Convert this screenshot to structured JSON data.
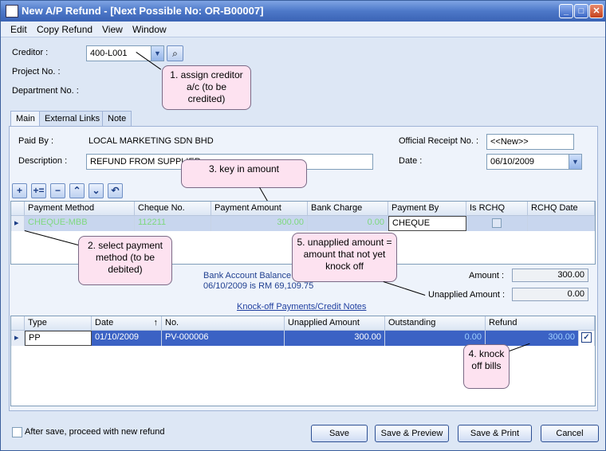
{
  "window": {
    "title": "New A/P Refund - [Next Possible No: OR-B00007]"
  },
  "menu": [
    "Edit",
    "Copy Refund",
    "View",
    "Window"
  ],
  "header": {
    "creditor_label": "Creditor :",
    "creditor_value": "400-L001",
    "project_label": "Project No. :",
    "department_label": "Department No. :"
  },
  "tabs": [
    "Main",
    "External Links",
    "Note"
  ],
  "main": {
    "paid_by_label": "Paid By :",
    "paid_by_value": "LOCAL MARKETING SDN BHD",
    "description_label": "Description :",
    "description_value": "REFUND FROM SUPPLIER",
    "receipt_label": "Official Receipt No. :",
    "receipt_value": "<<New>>",
    "date_label": "Date :",
    "date_value": "06/10/2009"
  },
  "payment_grid": {
    "columns": [
      "Payment Method",
      "Cheque No.",
      "Payment Amount",
      "Bank Charge",
      "Payment By",
      "Is RCHQ",
      "RCHQ Date"
    ],
    "row": {
      "method": "CHEQUE-MBB",
      "cheque_no": "112211",
      "amount": "300.00",
      "bank_charge": "0.00",
      "payment_by": "CHEQUE"
    }
  },
  "summary": {
    "bank_balance_line1": "Bank Account Balance",
    "bank_balance_line2": "06/10/2009 is RM 69,109.75",
    "amount_label": "Amount :",
    "amount_value": "300.00",
    "unapplied_label": "Unapplied Amount :",
    "unapplied_value": "0.00"
  },
  "knockoff": {
    "link": "Knock-off Payments/Credit Notes",
    "columns": [
      "Type",
      "Date",
      "No.",
      "Unapplied Amount",
      "Outstanding",
      "Refund"
    ],
    "row": {
      "type": "PP",
      "date": "01/10/2009",
      "no": "PV-000006",
      "unapplied": "300.00",
      "outstanding": "0.00",
      "refund": "300.00"
    }
  },
  "footer": {
    "checkbox_label": "After save, proceed with new refund",
    "buttons": [
      "Save",
      "Save & Preview",
      "Save & Print",
      "Cancel"
    ]
  },
  "callouts": {
    "c1": "1. assign creditor a/c (to be credited)",
    "c2": "2. select payment method (to be debited)",
    "c3": "3. key in amount",
    "c4": "4. knock off bills",
    "c5": "5. unapplied amount = amount that not yet knock off"
  },
  "colors": {
    "title_bar": "#3a63b5",
    "selected_row": "#3b62c4",
    "callout_bg": "#fde2f0",
    "payment_row_text": "#7fd87f"
  }
}
